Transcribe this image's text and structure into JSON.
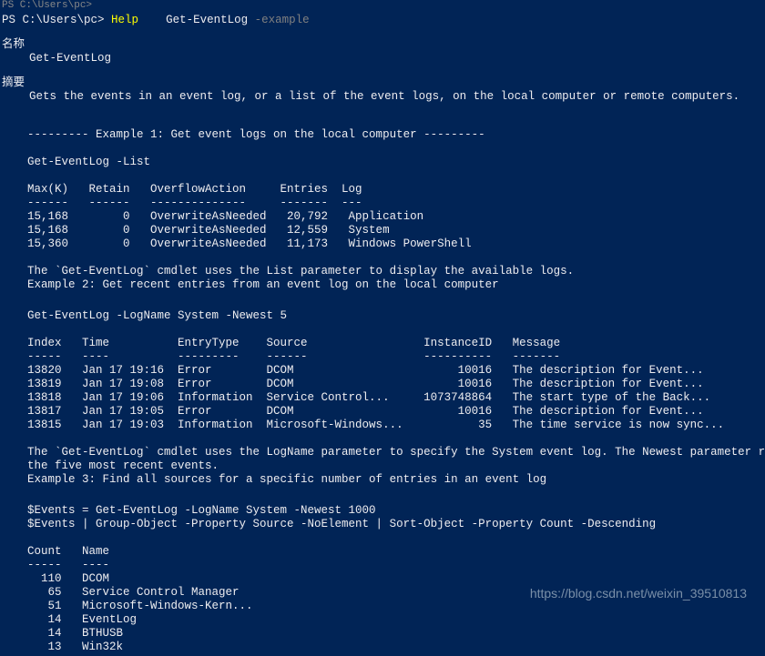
{
  "truncated_top": "PS C:\\Users\\pc>",
  "prompt": {
    "path": "PS C:\\Users\\pc>",
    "help": "Help",
    "cmd": "Get-EventLog",
    "param": "-example"
  },
  "name_section": {
    "header": "名称",
    "value": "Get-EventLog"
  },
  "synopsis_section": {
    "header": "摘要",
    "value": "Gets the events in an event log, or a list of the event logs, on the local computer or remote computers."
  },
  "example1": {
    "header": "--------- Example 1: Get event logs on the local computer ---------",
    "command": "Get-EventLog -List",
    "table_headers": "Max(K)   Retain   OverflowAction     Entries  Log",
    "table_sep": "------   ------   --------------     -------  ---",
    "rows": [
      "15,168        0   OverwriteAsNeeded   20,792   Application",
      "15,168        0   OverwriteAsNeeded   12,559   System",
      "15,360        0   OverwriteAsNeeded   11,173   Windows PowerShell"
    ],
    "note1": "The `Get-EventLog` cmdlet uses the List parameter to display the available logs.",
    "note2": "Example 2: Get recent entries from an event log on the local computer"
  },
  "example2": {
    "command": "Get-EventLog -LogName System -Newest 5",
    "table_headers": "Index   Time          EntryType    Source                 InstanceID   Message",
    "table_sep": "-----   ----          ---------    ------                 ----------   -------",
    "rows": [
      "13820   Jan 17 19:16  Error        DCOM                        10016   The description for Event...",
      "13819   Jan 17 19:08  Error        DCOM                        10016   The description for Event...",
      "13818   Jan 17 19:06  Information  Service Control...     1073748864   The start type of the Back...",
      "13817   Jan 17 19:05  Error        DCOM                        10016   The description for Event...",
      "13815   Jan 17 19:03  Information  Microsoft-Windows...           35   The time service is now sync..."
    ],
    "note1": "The `Get-EventLog` cmdlet uses the LogName parameter to specify the System event log. The Newest parameter returns",
    "note2": "the five most recent events.",
    "note3": "Example 3: Find all sources for a specific number of entries in an event log"
  },
  "example3": {
    "command1": "$Events = Get-EventLog -LogName System -Newest 1000",
    "command2": "$Events | Group-Object -Property Source -NoElement | Sort-Object -Property Count -Descending",
    "table_headers": "Count   Name",
    "table_sep": "-----   ----",
    "rows": [
      "  110   DCOM",
      "   65   Service Control Manager",
      "   51   Microsoft-Windows-Kern...",
      "   14   EventLog",
      "   14   BTHUSB",
      "   13   Win32k"
    ]
  },
  "watermark": "https://blog.csdn.net/weixin_39510813"
}
